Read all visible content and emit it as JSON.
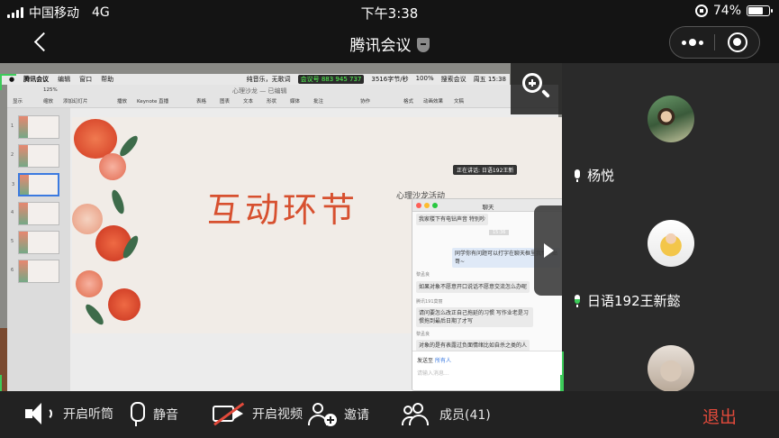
{
  "status_bar": {
    "carrier": "中国移动",
    "network": "4G",
    "time": "下午3:38",
    "battery_level": "74%",
    "battery_fraction": 0.74
  },
  "nav": {
    "title": "腾讯会议",
    "back_icon": "chevron-left-icon",
    "shield_icon": "shield-icon",
    "more_icon": "more-dots-icon",
    "record_icon": "target-icon"
  },
  "shared_screen": {
    "mac_menu": {
      "app": "腾讯会议",
      "items": [
        "编辑",
        "窗口",
        "帮助"
      ],
      "right_text": "纯音乐，无歌词",
      "meeting_id": "会议号 883 945 737",
      "net": "3516字节/秒",
      "battery": "100%",
      "search": "搜索会议",
      "clock": "周五 15:38"
    },
    "keynote": {
      "doc_title": "心理沙龙 — 已编辑",
      "toolbar": [
        "显示",
        "缩放",
        "添加幻灯片",
        "播放",
        "Keynote 直播",
        "表格",
        "图表",
        "文本",
        "形状",
        "媒体",
        "批注",
        "协作",
        "格式",
        "动画效果",
        "文稿"
      ],
      "zoom": "125%",
      "slide_numbers": [
        "1",
        "2",
        "3",
        "4",
        "5",
        "6"
      ],
      "slide_title": "互动环节",
      "slide_header": "心理沙龙活动"
    },
    "speaker_tip": "正在讲话: 日语192王新",
    "chat": {
      "title": "聊天",
      "messages": [
        {
          "sender": "",
          "text": "我家楼下有电钻声音 特别吵"
        },
        {
          "sender": "",
          "text": "15:36"
        },
        {
          "sender": "",
          "text": "同学你有问题可以打字在聊天框里我帮你贴哥~"
        },
        {
          "sender": "黎孟良",
          "text": "如果对象不愿意开口说话不愿意交流怎么办呢"
        },
        {
          "sender": "腾讯191莫丽",
          "text": "请问要怎么改正自己拖延的习惯 写作业老是习惯拖到最后日期了才写"
        },
        {
          "sender": "黎孟良",
          "text": "对象的是有表露过负面情绪比如自杀之类的人"
        }
      ],
      "send_to_label": "发送至",
      "send_to_target": "所有人",
      "input_placeholder": "请输入消息..."
    }
  },
  "participants": [
    {
      "name": "杨悦",
      "mic": "mic-icon"
    },
    {
      "name": "日语192王新懿",
      "mic": "mic-active-icon"
    },
    {
      "name": "",
      "mic": ""
    }
  ],
  "bottom_bar": {
    "speaker_label": "开启听筒",
    "mute_label": "静音",
    "video_label": "开启视频",
    "invite_label": "邀请",
    "members_label": "成员(41)",
    "exit_label": "退出"
  },
  "colors": {
    "accent_green": "#3ccb59",
    "exit_red": "#e24a3b",
    "slide_title": "#d7502f"
  }
}
